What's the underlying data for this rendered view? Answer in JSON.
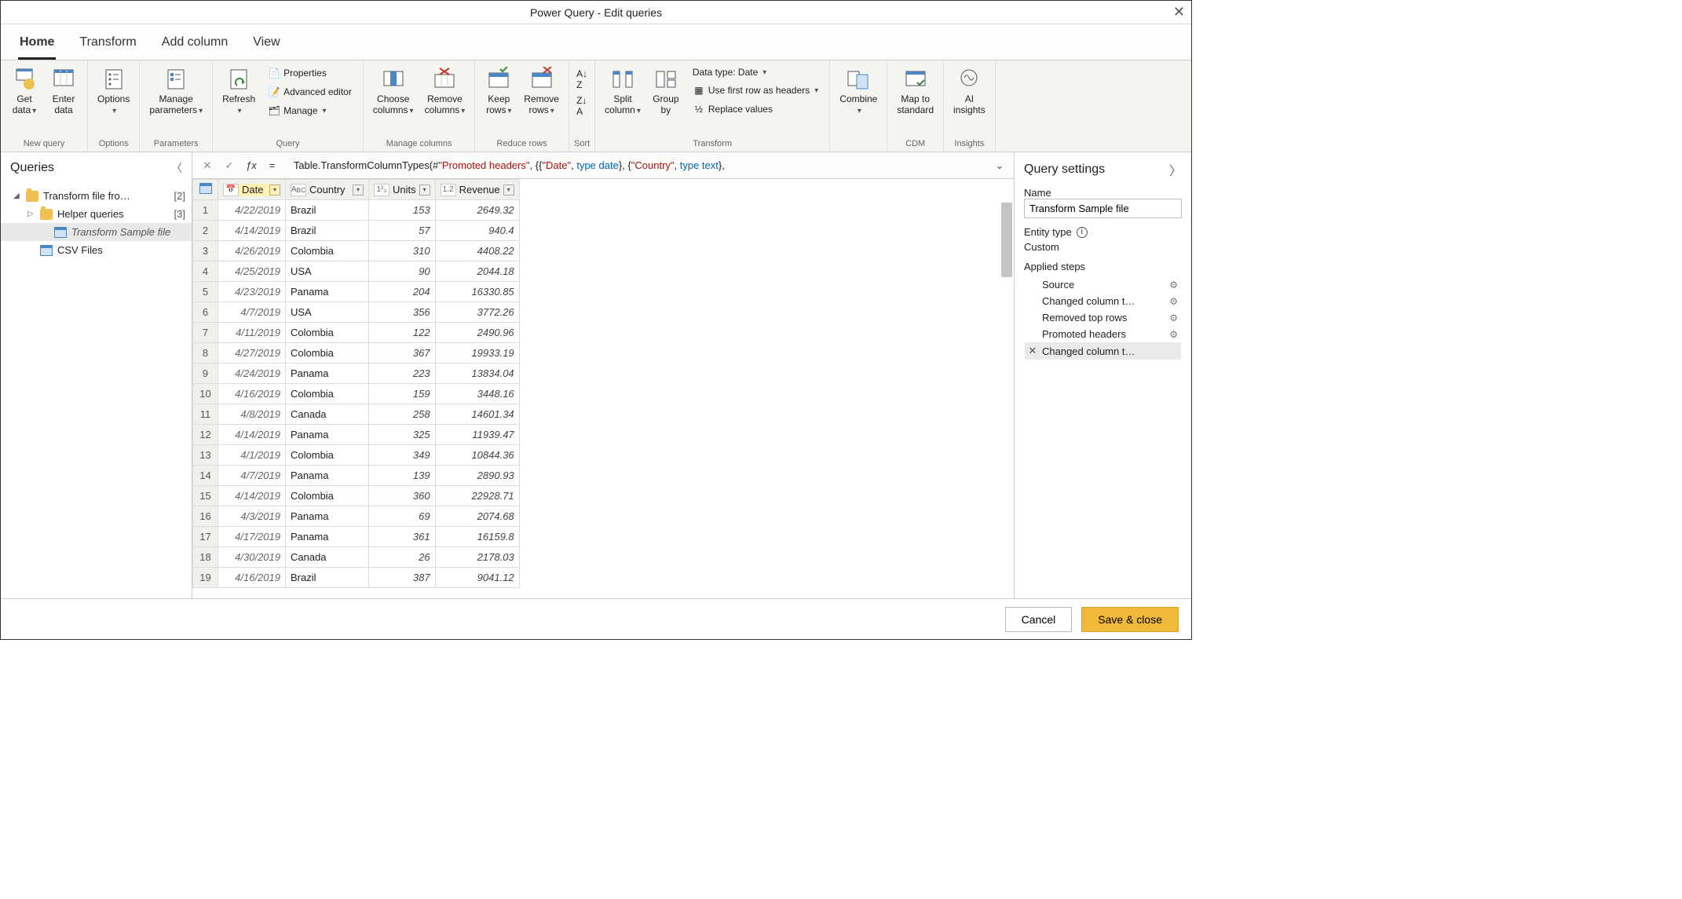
{
  "window": {
    "title": "Power Query - Edit queries"
  },
  "tabs": [
    "Home",
    "Transform",
    "Add column",
    "View"
  ],
  "ribbon": {
    "new_query": {
      "label": "New query",
      "get_data": "Get\ndata",
      "enter_data": "Enter\ndata"
    },
    "options": {
      "label": "Options",
      "options": "Options"
    },
    "parameters": {
      "label": "Parameters",
      "manage": "Manage\nparameters"
    },
    "query": {
      "label": "Query",
      "refresh": "Refresh",
      "properties": "Properties",
      "advanced": "Advanced editor",
      "manage": "Manage"
    },
    "manage_columns": {
      "label": "Manage columns",
      "choose": "Choose\ncolumns",
      "remove": "Remove\ncolumns"
    },
    "reduce_rows": {
      "label": "Reduce rows",
      "keep": "Keep\nrows",
      "remove": "Remove\nrows"
    },
    "sort": {
      "label": "Sort"
    },
    "transform": {
      "label": "Transform",
      "split": "Split\ncolumn",
      "group": "Group\nby",
      "datatype": "Data type: Date",
      "first_row": "Use first row as headers",
      "replace": "Replace values"
    },
    "combine": {
      "label": "",
      "combine": "Combine"
    },
    "cdm": {
      "label": "CDM",
      "map": "Map to\nstandard"
    },
    "insights": {
      "label": "Insights",
      "ai": "AI\ninsights"
    }
  },
  "queries_panel": {
    "title": "Queries",
    "items": [
      {
        "label": "Transform file fro…",
        "count": "[2]",
        "type": "folder",
        "expanded": true,
        "indent": 1
      },
      {
        "label": "Helper queries",
        "count": "[3]",
        "type": "folder",
        "expanded": false,
        "indent": 2
      },
      {
        "label": "Transform Sample file",
        "type": "table",
        "indent": 3,
        "selected": true
      },
      {
        "label": "CSV Files",
        "type": "table",
        "indent": 2
      }
    ]
  },
  "formula": {
    "eq": "=",
    "fn_open": "Table.TransformColumnTypes(#",
    "str1": "\"Promoted headers\"",
    "mid1": ", {{",
    "str2": "\"Date\"",
    "mid2": ", ",
    "kw1": "type date",
    "mid3": "}, {",
    "str3": "\"Country\"",
    "mid4": ", ",
    "kw2": "type text",
    "end": "},"
  },
  "columns": [
    "Date",
    "Country",
    "Units",
    "Revenue"
  ],
  "rows": [
    {
      "n": 1,
      "date": "4/22/2019",
      "country": "Brazil",
      "units": 153,
      "rev": "2649.32"
    },
    {
      "n": 2,
      "date": "4/14/2019",
      "country": "Brazil",
      "units": 57,
      "rev": "940.4"
    },
    {
      "n": 3,
      "date": "4/26/2019",
      "country": "Colombia",
      "units": 310,
      "rev": "4408.22"
    },
    {
      "n": 4,
      "date": "4/25/2019",
      "country": "USA",
      "units": 90,
      "rev": "2044.18"
    },
    {
      "n": 5,
      "date": "4/23/2019",
      "country": "Panama",
      "units": 204,
      "rev": "16330.85"
    },
    {
      "n": 6,
      "date": "4/7/2019",
      "country": "USA",
      "units": 356,
      "rev": "3772.26"
    },
    {
      "n": 7,
      "date": "4/11/2019",
      "country": "Colombia",
      "units": 122,
      "rev": "2490.96"
    },
    {
      "n": 8,
      "date": "4/27/2019",
      "country": "Colombia",
      "units": 367,
      "rev": "19933.19"
    },
    {
      "n": 9,
      "date": "4/24/2019",
      "country": "Panama",
      "units": 223,
      "rev": "13834.04"
    },
    {
      "n": 10,
      "date": "4/16/2019",
      "country": "Colombia",
      "units": 159,
      "rev": "3448.16"
    },
    {
      "n": 11,
      "date": "4/8/2019",
      "country": "Canada",
      "units": 258,
      "rev": "14601.34"
    },
    {
      "n": 12,
      "date": "4/14/2019",
      "country": "Panama",
      "units": 325,
      "rev": "11939.47"
    },
    {
      "n": 13,
      "date": "4/1/2019",
      "country": "Colombia",
      "units": 349,
      "rev": "10844.36"
    },
    {
      "n": 14,
      "date": "4/7/2019",
      "country": "Panama",
      "units": 139,
      "rev": "2890.93"
    },
    {
      "n": 15,
      "date": "4/14/2019",
      "country": "Colombia",
      "units": 360,
      "rev": "22928.71"
    },
    {
      "n": 16,
      "date": "4/3/2019",
      "country": "Panama",
      "units": 69,
      "rev": "2074.68"
    },
    {
      "n": 17,
      "date": "4/17/2019",
      "country": "Panama",
      "units": 361,
      "rev": "16159.8"
    },
    {
      "n": 18,
      "date": "4/30/2019",
      "country": "Canada",
      "units": 26,
      "rev": "2178.03"
    },
    {
      "n": 19,
      "date": "4/16/2019",
      "country": "Brazil",
      "units": 387,
      "rev": "9041.12"
    }
  ],
  "settings": {
    "title": "Query settings",
    "name_label": "Name",
    "name_value": "Transform Sample file",
    "entity_type_label": "Entity type",
    "entity_type_value": "Custom",
    "steps_label": "Applied steps",
    "steps": [
      {
        "label": "Source",
        "gear": true
      },
      {
        "label": "Changed column t…",
        "gear": true
      },
      {
        "label": "Removed top rows",
        "gear": true
      },
      {
        "label": "Promoted headers",
        "gear": true
      },
      {
        "label": "Changed column t…",
        "gear": false,
        "selected": true,
        "x": true
      }
    ]
  },
  "footer": {
    "cancel": "Cancel",
    "save": "Save & close"
  }
}
